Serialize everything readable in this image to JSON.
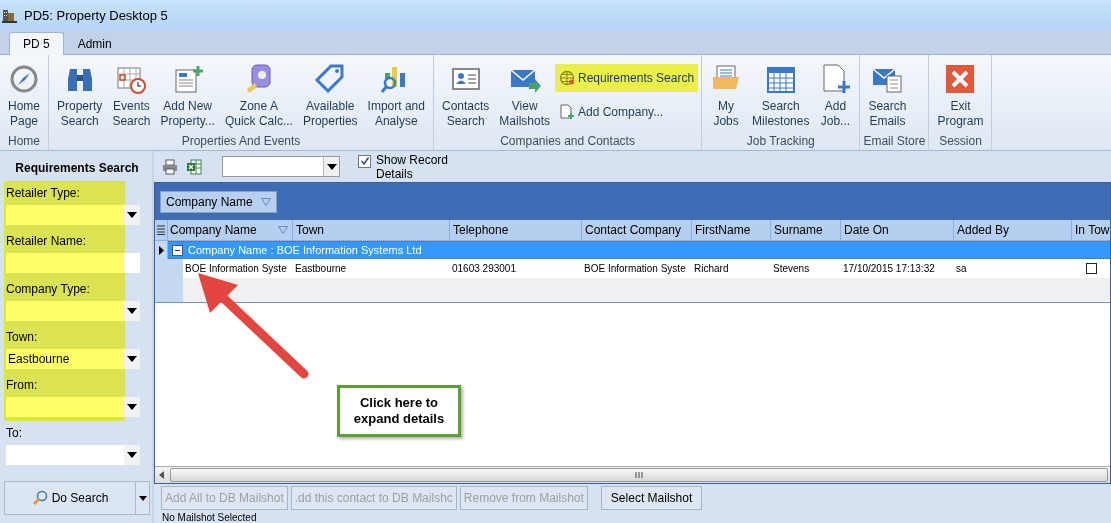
{
  "window": {
    "title": "PD5: Property Desktop 5"
  },
  "tabs": [
    {
      "label": "PD 5",
      "selected": true
    },
    {
      "label": "Admin",
      "selected": false
    }
  ],
  "ribbon": {
    "groups": [
      {
        "label": "Home",
        "buttons": [
          {
            "label": "Home\nPage",
            "kind": "large",
            "highlighted": false
          }
        ]
      },
      {
        "label": "Properties And Events",
        "buttons": [
          {
            "label": "Property\nSearch",
            "kind": "large",
            "highlighted": false
          },
          {
            "label": "Events\nSearch",
            "kind": "large",
            "highlighted": false
          },
          {
            "label": "Add New\nProperty...",
            "kind": "large",
            "highlighted": false
          },
          {
            "label": "Zone A\nQuick Calc...",
            "kind": "large",
            "highlighted": false
          },
          {
            "label": "Available\nProperties",
            "kind": "large",
            "highlighted": false
          },
          {
            "label": "Import and\nAnalyse",
            "kind": "large",
            "highlighted": false
          }
        ]
      },
      {
        "label": "Companies and Contacts",
        "buttons": [
          {
            "label": "Contacts\nSearch",
            "kind": "large",
            "highlighted": false
          },
          {
            "label": "View\nMailshots",
            "kind": "large",
            "highlighted": false
          },
          {
            "label": "Requirements Search",
            "kind": "small",
            "highlighted": true
          },
          {
            "label": "Add Company...",
            "kind": "small",
            "highlighted": false
          }
        ]
      },
      {
        "label": "Job Tracking",
        "buttons": [
          {
            "label": "My\nJobs",
            "kind": "large",
            "highlighted": false
          },
          {
            "label": "Search\nMilestones",
            "kind": "large",
            "highlighted": false
          },
          {
            "label": "Add\nJob...",
            "kind": "large",
            "highlighted": false
          }
        ]
      },
      {
        "label": "Email Store",
        "buttons": [
          {
            "label": "Search\nEmails",
            "kind": "large",
            "highlighted": false
          }
        ]
      },
      {
        "label": "Session",
        "buttons": [
          {
            "label": "Exit\nProgram",
            "kind": "large",
            "highlighted": false
          }
        ]
      }
    ]
  },
  "sidebar": {
    "title": "Requirements Search",
    "fields": [
      {
        "label": "Retailer Type:",
        "kind": "dropdown",
        "highlighted": true
      },
      {
        "label": "Retailer Name:",
        "kind": "text",
        "highlighted": true
      },
      {
        "label": "Company Type:",
        "kind": "dropdown",
        "highlighted": true
      },
      {
        "label": "Town:",
        "kind": "dropdown",
        "value": "Eastbourne",
        "highlighted": true
      },
      {
        "label": "From:",
        "kind": "dropdown",
        "highlighted": true
      },
      {
        "label": "To:",
        "kind": "dropdown",
        "highlighted": false
      }
    ],
    "search_button": "Do Search"
  },
  "toolbar": {
    "show_record_details": {
      "label": "Show Record Details",
      "checked": true
    }
  },
  "grid": {
    "group_by": "Company Name",
    "columns": [
      {
        "label": "Company Name",
        "filter": true
      },
      {
        "label": "Town",
        "filter": false
      },
      {
        "label": "Telephone",
        "filter": false
      },
      {
        "label": "Contact Company",
        "filter": false
      },
      {
        "label": "FirstName",
        "filter": false
      },
      {
        "label": "Surname",
        "filter": false
      },
      {
        "label": "Date On",
        "filter": false
      },
      {
        "label": "Added By",
        "filter": false
      },
      {
        "label": "In Tow",
        "filter": false
      }
    ],
    "group_row": {
      "label": "Company Name : BOE Information Systems Ltd",
      "expanded": true
    },
    "rows": [
      {
        "cells": [
          "BOE Information Syste",
          "Eastbourne",
          "01603 293001",
          "BOE Information Syste",
          "Richard",
          "Stevens",
          "17/10/2015 17:13:32",
          "sa"
        ],
        "in_tow": false
      }
    ]
  },
  "actions": [
    {
      "label": "Add All to DB Mailshot",
      "disabled": true
    },
    {
      "label": ".dd this contact to DB Mailshc",
      "disabled": true
    },
    {
      "label": "Remove from Mailshot",
      "disabled": true
    },
    {
      "label": "Select Mailshot",
      "disabled": false
    }
  ],
  "status": "No Mailshot Selected",
  "annotation": {
    "callout": "Click here to expand details"
  }
}
